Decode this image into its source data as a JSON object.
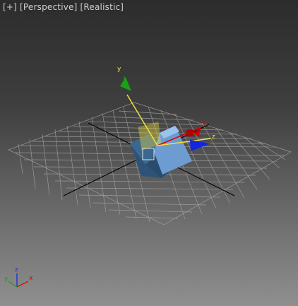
{
  "viewport": {
    "menus": [
      "[+]",
      "[Perspective]",
      "[Realistic]"
    ],
    "colors": {
      "grid": "#a9a9a9",
      "grid_axis": "#000000",
      "object_light": "#6f9fd6",
      "object_dark": "#2f5377",
      "gizmo_x": "#e00000",
      "gizmo_y": "#18a018",
      "gizmo_z": "#1226e0",
      "gizmo_selected": "#f2e23a"
    }
  },
  "gizmo": {
    "x_label": "x",
    "y_label": "y",
    "z_label": "z",
    "icons": [
      "move-gizmo-icon"
    ]
  },
  "axis_tripod": {
    "x_label": "x",
    "y_label": "y",
    "z_label": "z",
    "icons": [
      "axis-tripod-icon"
    ]
  }
}
